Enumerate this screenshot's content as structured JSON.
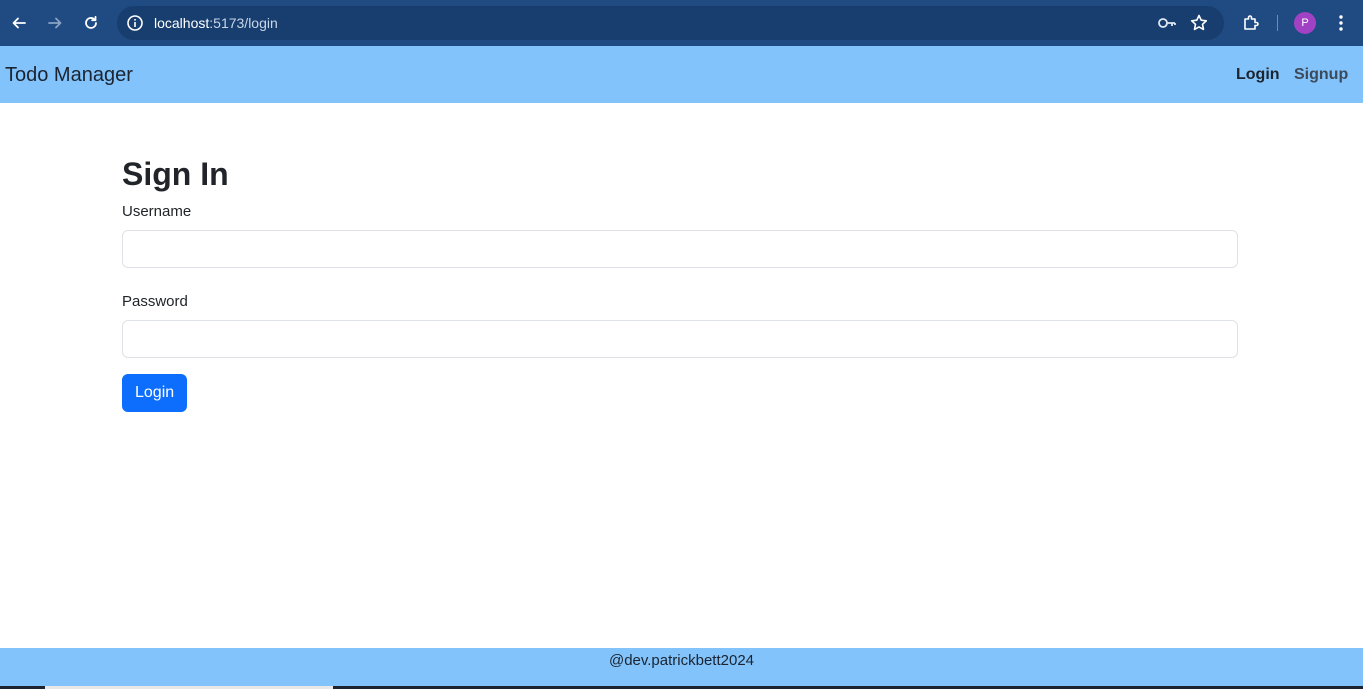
{
  "browser": {
    "url_host": "localhost",
    "url_path": ":5173/login",
    "profile_initial": "P",
    "icons": [
      "back-arrow-icon",
      "forward-arrow-icon",
      "reload-icon",
      "site-info-icon",
      "password-key-icon",
      "bookmark-star-icon",
      "extensions-icon",
      "more-vert-icon"
    ]
  },
  "navbar": {
    "brand": "Todo Manager",
    "links": [
      "Login",
      "Signup"
    ]
  },
  "form": {
    "title": "Sign In",
    "username_label": "Username",
    "username_value": "",
    "password_label": "Password",
    "password_value": "",
    "submit_label": "Login"
  },
  "footer": {
    "text": "@dev.patrickbett2024"
  },
  "colors": {
    "chrome": "#1f4a82",
    "navbar": "#82c3fb",
    "primary_button": "#0d6efd",
    "avatar": "#a142c4"
  }
}
